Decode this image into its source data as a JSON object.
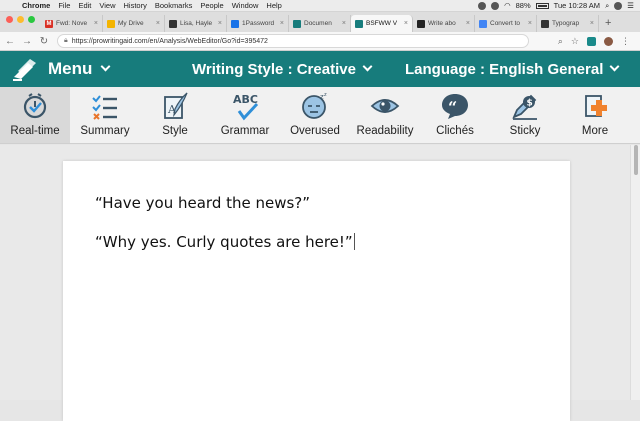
{
  "mac_menubar": {
    "app": "Chrome",
    "items": [
      "File",
      "Edit",
      "View",
      "History",
      "Bookmarks",
      "People",
      "Window",
      "Help"
    ],
    "battery": "88%",
    "clock": "Tue 10:28 AM"
  },
  "tabs": [
    {
      "title": "Fwd: Nove",
      "favicon": "gmail-icon",
      "color": "#d93025",
      "glyph": "M",
      "active": false
    },
    {
      "title": "My Drive",
      "favicon": "drive-icon",
      "color": "#f4b400",
      "glyph": "",
      "active": false
    },
    {
      "title": "Lisa, Hayle",
      "favicon": "notion-icon",
      "color": "#333333",
      "glyph": "",
      "active": false
    },
    {
      "title": "1Password",
      "favicon": "1password-icon",
      "color": "#1a73e8",
      "glyph": "",
      "active": false
    },
    {
      "title": "Documen",
      "favicon": "prowritingaid-icon",
      "color": "#177c7c",
      "glyph": "",
      "active": false
    },
    {
      "title": "BSFWW V",
      "favicon": "prowritingaid-icon",
      "color": "#177c7c",
      "glyph": "",
      "active": true
    },
    {
      "title": "Write abo",
      "favicon": "medium-icon",
      "color": "#222222",
      "glyph": "",
      "active": false
    },
    {
      "title": "Convert to",
      "favicon": "docs-icon",
      "color": "#4285f4",
      "glyph": "",
      "active": false
    },
    {
      "title": "Typograp",
      "favicon": "typography-icon",
      "color": "#333333",
      "glyph": "",
      "active": false
    }
  ],
  "address": {
    "url": "https://prowritingaid.com/en/Analysis/WebEditor/Go?id=395472"
  },
  "header": {
    "menu_label": "Menu",
    "writing_style_label": "Writing Style : Creative",
    "language_label": "Language : English General",
    "brand_color": "#177c7c"
  },
  "toolbar": {
    "items": [
      {
        "label": "Real-time",
        "icon": "clock-check-icon",
        "active": true
      },
      {
        "label": "Summary",
        "icon": "checklist-icon",
        "active": false
      },
      {
        "label": "Style",
        "icon": "style-feather-icon",
        "active": false
      },
      {
        "label": "Grammar",
        "icon": "abc-check-icon",
        "active": false
      },
      {
        "label": "Overused",
        "icon": "tired-face-icon",
        "active": false
      },
      {
        "label": "Readability",
        "icon": "eye-icon",
        "active": false
      },
      {
        "label": "Clichés",
        "icon": "quote-bubble-icon",
        "active": false
      },
      {
        "label": "Sticky",
        "icon": "sticky-pen-icon",
        "active": false
      },
      {
        "label": "More",
        "icon": "plus-document-icon",
        "active": false
      }
    ]
  },
  "document": {
    "paragraphs": [
      "“Have you heard the news?”",
      "“Why yes. Curly quotes are here!”"
    ]
  }
}
